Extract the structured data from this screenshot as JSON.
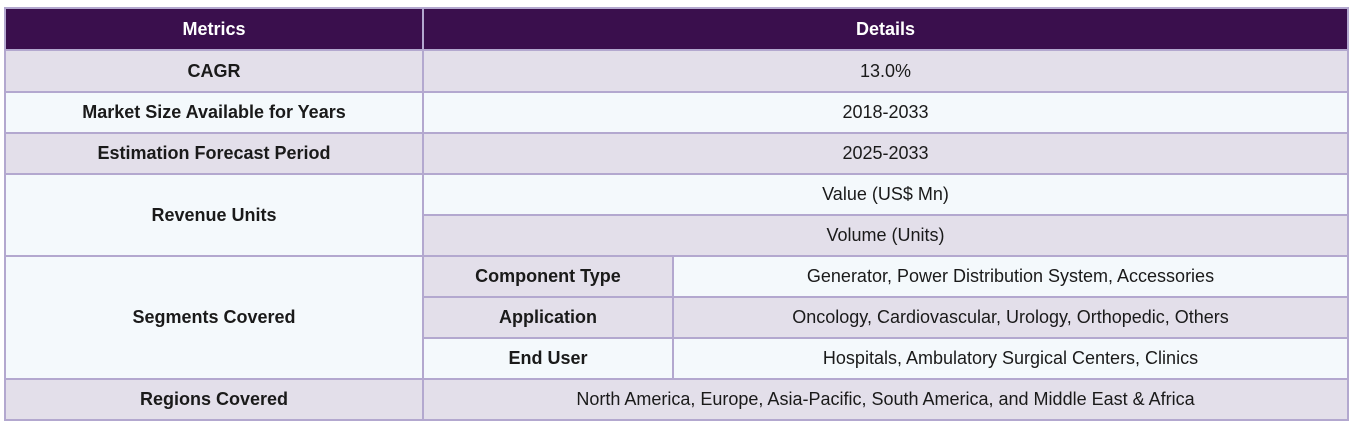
{
  "headers": {
    "metrics": "Metrics",
    "details": "Details"
  },
  "rows": {
    "cagr": {
      "label": "CAGR",
      "value": "13.0%"
    },
    "market_size": {
      "label": "Market Size Available for Years",
      "value": "2018-2033"
    },
    "forecast": {
      "label": "Estimation Forecast Period",
      "value": "2025-2033"
    },
    "revenue_units": {
      "label": "Revenue Units",
      "values": [
        "Value (US$ Mn)",
        "Volume (Units)"
      ]
    },
    "segments": {
      "label": "Segments Covered",
      "items": [
        {
          "name": "Component Type",
          "value": "Generator, Power Distribution System, Accessories"
        },
        {
          "name": "Application",
          "value": "Oncology, Cardiovascular, Urology, Orthopedic, Others"
        },
        {
          "name": "End User",
          "value": "Hospitals, Ambulatory Surgical Centers, Clinics"
        }
      ]
    },
    "regions": {
      "label": "Regions Covered",
      "value": "North America, Europe, Asia-Pacific, South America, and Middle East & Africa"
    }
  },
  "colors": {
    "header_bg": "#3a0f4d",
    "shade_bg": "#e3dfea",
    "light_bg": "#f4f9fc",
    "border": "#b3a8cf"
  }
}
